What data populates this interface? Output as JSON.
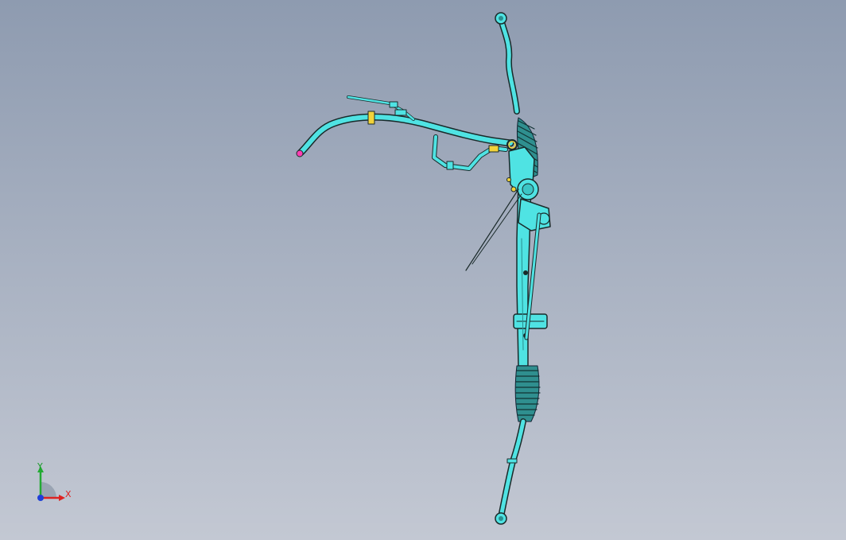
{
  "viewport": {
    "background_top": "#8e9bb0",
    "background_bottom": "#c3c8d3"
  },
  "model": {
    "body_color": "#4fe3e3",
    "outline_color": "#1a2a2a",
    "bellows_color": "#2f8f8f",
    "clamp_color": "#f2d33a",
    "accent_color": "#ff3fb3"
  },
  "triad": {
    "x_label": "X",
    "y_label": "Y",
    "x_color": "#dd2222",
    "y_color": "#22aa33",
    "z_color": "#1f3fd8"
  }
}
